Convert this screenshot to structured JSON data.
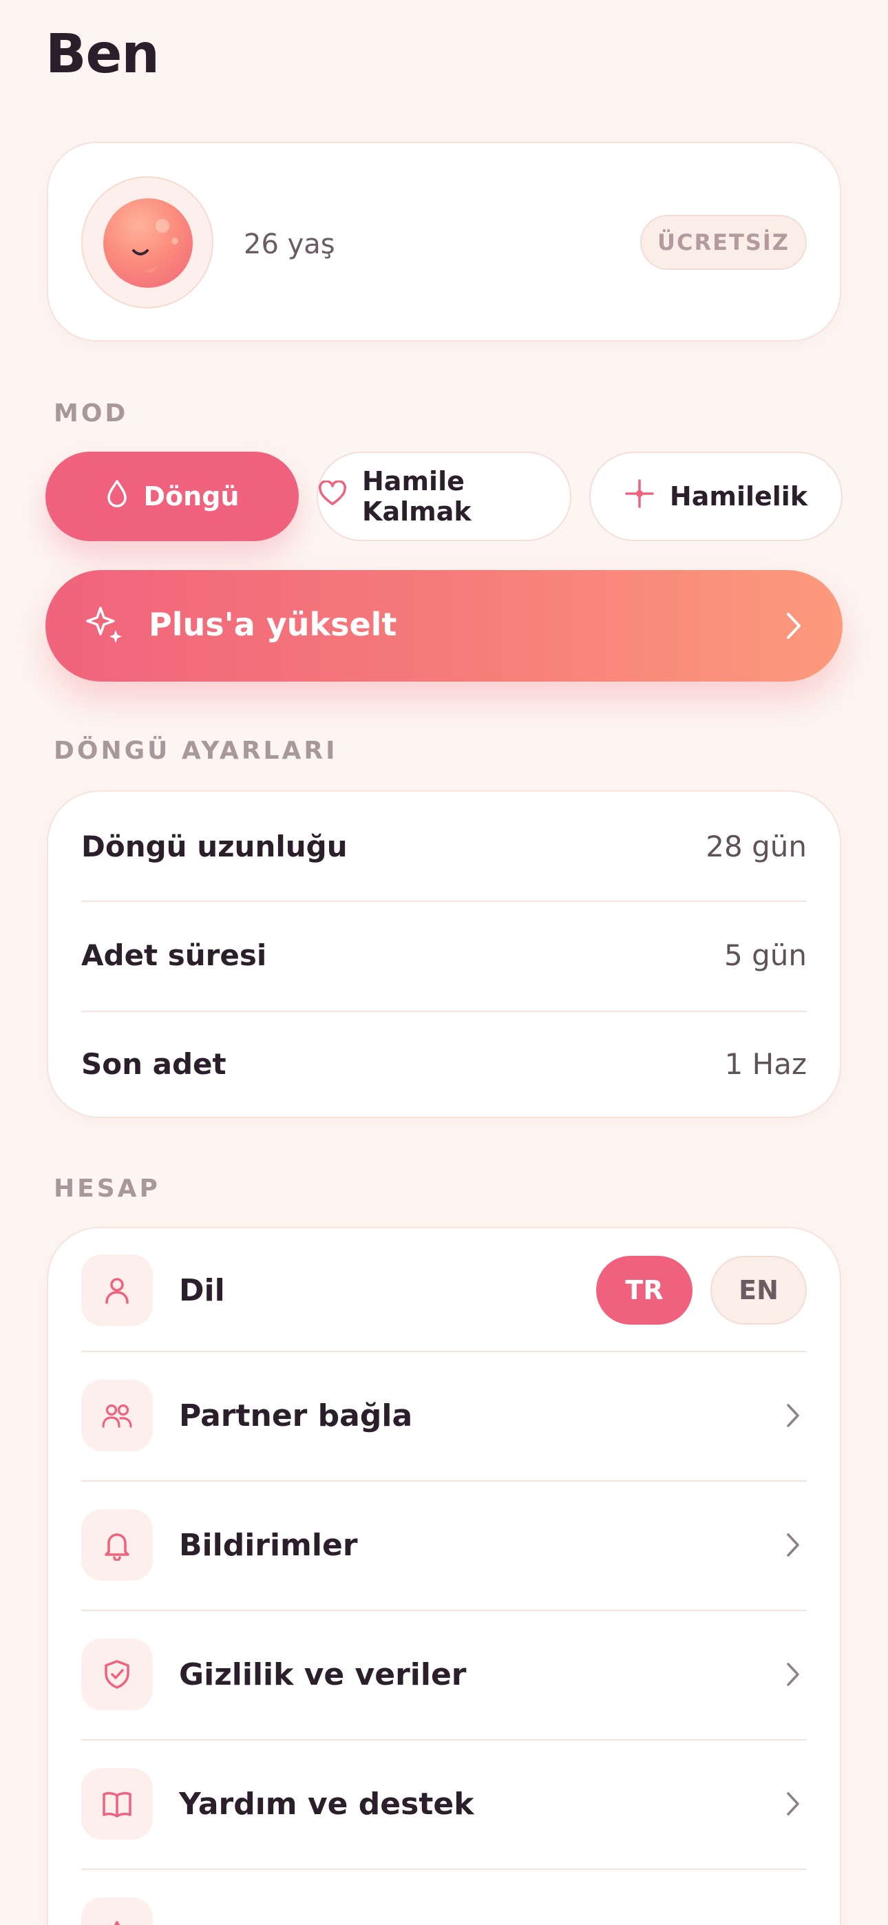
{
  "header": {
    "title": "Ben"
  },
  "profile": {
    "age_text": "26 yaş",
    "plan_badge": "ÜCRETSİZ"
  },
  "mode": {
    "section_label": "MOD",
    "options": [
      {
        "label": "Döngü",
        "icon": "drop-icon",
        "active": true
      },
      {
        "label": "Hamile Kalmak",
        "icon": "heart-icon",
        "active": false
      },
      {
        "label": "Hamilelik",
        "icon": "sparkle-icon",
        "active": false
      }
    ]
  },
  "upgrade": {
    "label": "Plus'a yükselt"
  },
  "cycle_settings": {
    "section_label": "DÖNGÜ AYARLARI",
    "rows": [
      {
        "label": "Döngü uzunluğu",
        "value": "28 gün"
      },
      {
        "label": "Adet süresi",
        "value": "5 gün"
      },
      {
        "label": "Son adet",
        "value": "1 Haz"
      }
    ]
  },
  "account": {
    "section_label": "HESAP",
    "language": {
      "label": "Dil",
      "options": [
        "TR",
        "EN"
      ],
      "selected": "TR"
    },
    "items": [
      {
        "label": "Partner bağla",
        "icon": "users-icon"
      },
      {
        "label": "Bildirimler",
        "icon": "bell-icon"
      },
      {
        "label": "Gizlilik ve veriler",
        "icon": "shield-check-icon"
      },
      {
        "label": "Yardım ve destek",
        "icon": "book-icon"
      }
    ]
  },
  "colors": {
    "accent": "#f0617e",
    "background": "#fdf5f1",
    "upgrade_gradient_start": "#f0637c",
    "upgrade_gradient_end": "#fc9a7c"
  }
}
